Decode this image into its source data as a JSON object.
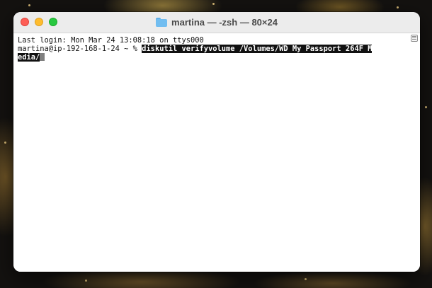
{
  "window": {
    "title": "martina — -zsh — 80×24"
  },
  "terminal": {
    "last_login": "Last login: Mon Mar 24 13:08:18 on ttys000",
    "prompt": "martina@ip-192-168-1-24 ~ % ",
    "command_line1": "diskutil verifyvolume /Volumes/WD My Passport 264F M",
    "command_line2": "edia/"
  },
  "colors": {
    "close": "#fe5f57",
    "minimize": "#febc2e",
    "zoom": "#28c840",
    "selection": "#111111"
  },
  "icons": {
    "title_icon": "folder-icon",
    "scroll_marker": "marks-icon"
  }
}
